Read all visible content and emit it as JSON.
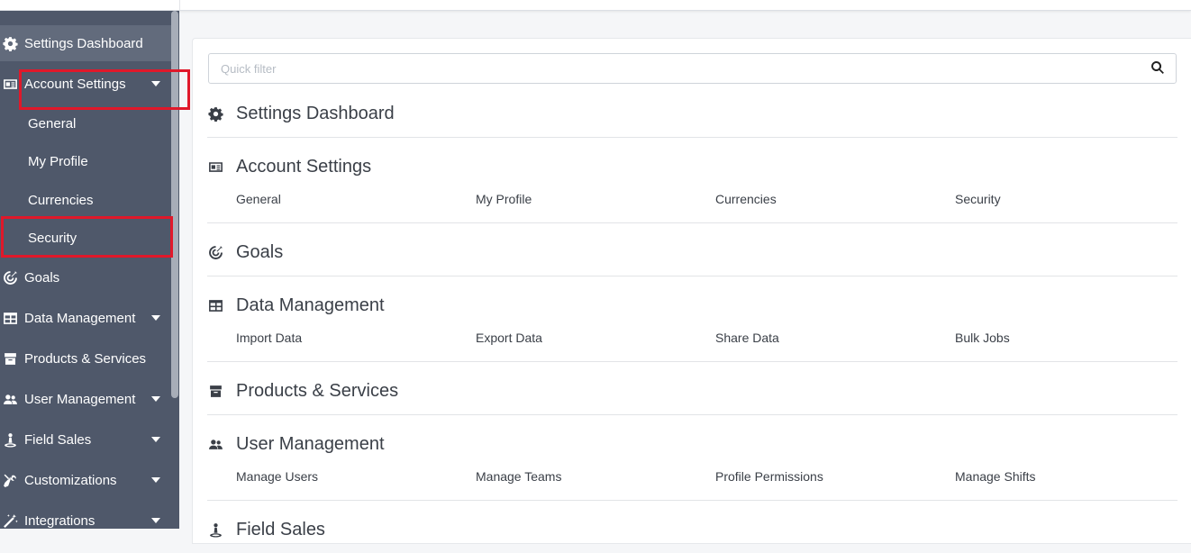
{
  "sidebar": {
    "items": [
      {
        "label": "Settings Dashboard",
        "icon": "gear-icon"
      },
      {
        "label": "Account Settings",
        "icon": "id-card-icon"
      },
      {
        "label": "Goals",
        "icon": "target-icon"
      },
      {
        "label": "Data Management",
        "icon": "table-icon"
      },
      {
        "label": "Products & Services",
        "icon": "box-icon"
      },
      {
        "label": "User Management",
        "icon": "users-icon"
      },
      {
        "label": "Field Sales",
        "icon": "person-pin-icon"
      },
      {
        "label": "Customizations",
        "icon": "tools-icon"
      },
      {
        "label": "Integrations",
        "icon": "magic-wand-icon"
      }
    ],
    "account_sub": [
      "General",
      "My Profile",
      "Currencies",
      "Security"
    ]
  },
  "main": {
    "search": {
      "placeholder": "Quick filter"
    },
    "sections": [
      {
        "title": "Settings Dashboard",
        "icon": "gear-icon",
        "links": []
      },
      {
        "title": "Account Settings",
        "icon": "id-card-icon",
        "links": [
          "General",
          "My Profile",
          "Currencies",
          "Security"
        ]
      },
      {
        "title": "Goals",
        "icon": "target-icon",
        "links": []
      },
      {
        "title": "Data Management",
        "icon": "table-icon",
        "links": [
          "Import Data",
          "Export Data",
          "Share Data",
          "Bulk Jobs"
        ]
      },
      {
        "title": "Products & Services",
        "icon": "box-icon",
        "links": []
      },
      {
        "title": "User Management",
        "icon": "users-icon",
        "links": [
          "Manage Users",
          "Manage Teams",
          "Profile Permissions",
          "Manage Shifts"
        ]
      },
      {
        "title": "Field Sales",
        "icon": "person-pin-icon",
        "links": []
      }
    ]
  },
  "colors": {
    "sidebar_bg": "#4f586a",
    "sidebar_active": "#626b7c",
    "highlight": "#e0182a",
    "text": "#3a3f47"
  }
}
